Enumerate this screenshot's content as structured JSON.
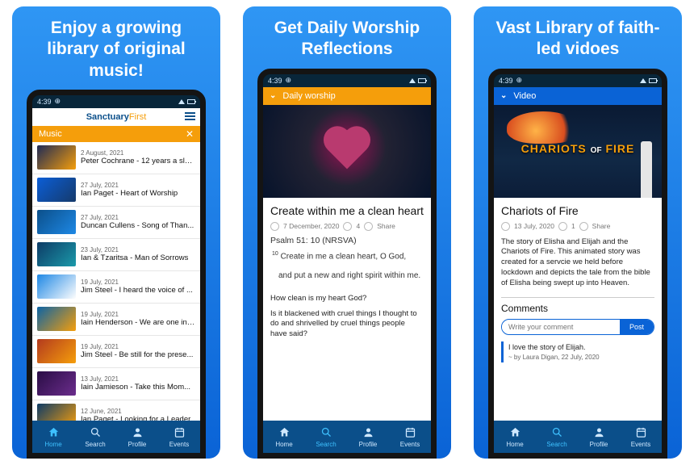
{
  "status_time": "4:39",
  "brand": {
    "a": "Sanctuary",
    "b": "First"
  },
  "panels": [
    {
      "headline": "Enjoy a growing library of original music!",
      "section": "Music",
      "nav_active": 0
    },
    {
      "headline": "Get Daily Worship Reflections",
      "section": "Daily worship",
      "nav_active": 1
    },
    {
      "headline": "Vast Library of faith-led vidoes",
      "section": "Video",
      "nav_active": 1
    }
  ],
  "music": [
    {
      "date": "2 August, 2021",
      "title": "Peter Cochrane - 12 years a sla...",
      "c1": "#1e2a55",
      "c2": "#f59e0b"
    },
    {
      "date": "27 July, 2021",
      "title": "Ian Paget - Heart of Worship",
      "c1": "#0b5ed7",
      "c2": "#153a6b"
    },
    {
      "date": "27 July, 2021",
      "title": "Duncan Cullens - Song of Than...",
      "c1": "#0b4f8a",
      "c2": "#1e88e5"
    },
    {
      "date": "23 July, 2021",
      "title": "Ian & Tzaritsa - Man of Sorrows",
      "c1": "#0d3b66",
      "c2": "#1b9aaa"
    },
    {
      "date": "19 July, 2021",
      "title": "Jim Steel - I heard the voice of ...",
      "c1": "#1e88e5",
      "c2": "#fdfdfd"
    },
    {
      "date": "19 July, 2021",
      "title": "Iain Henderson - We are one in ...",
      "c1": "#0b63a5",
      "c2": "#f59e0b"
    },
    {
      "date": "19 July, 2021",
      "title": "Jim Steel - Be still for the prese...",
      "c1": "#b33a1e",
      "c2": "#f59e0b"
    },
    {
      "date": "13 July, 2021",
      "title": "Iain Jamieson - Take this Mom...",
      "c1": "#2a0d45",
      "c2": "#6b2d8c"
    },
    {
      "date": "12 June, 2021",
      "title": "Ian Paget - Looking for a Leader",
      "c1": "#0d3b66",
      "c2": "#f59e0b"
    }
  ],
  "worship": {
    "title": "Create within me a clean heart",
    "date": "7 December, 2020",
    "comments": "4",
    "share": "Share",
    "subtitle": "Psalm 51: 10 (NRSVA)",
    "verse_num": "10",
    "verse_a": "Create in me a clean heart, O God,",
    "verse_b": "and put a new and right spirit within me.",
    "q": "How clean is my heart God?",
    "p": "Is it blackened with cruel things I thought to do and shrivelled by cruel things people have said?"
  },
  "video": {
    "title": "Chariots of Fire",
    "date": "13 July, 2020",
    "comments": "1",
    "share": "Share",
    "banner_a": "CHARIOTS",
    "banner_of": "OF",
    "banner_b": "FIRE",
    "desc": "The story of Elisha and Elijah and the Chariots of Fire. This animated story was created for a servcie we held before lockdown and depicts the tale from the bible of Elisha being swept up into Heaven.",
    "comments_h": "Comments",
    "placeholder": "Write your comment",
    "post": "Post",
    "c_text": "I love the story of Elijah.",
    "c_by": "~ by Laura Digan, 22 July, 2020"
  },
  "nav": [
    "Home",
    "Search",
    "Profile",
    "Events"
  ]
}
